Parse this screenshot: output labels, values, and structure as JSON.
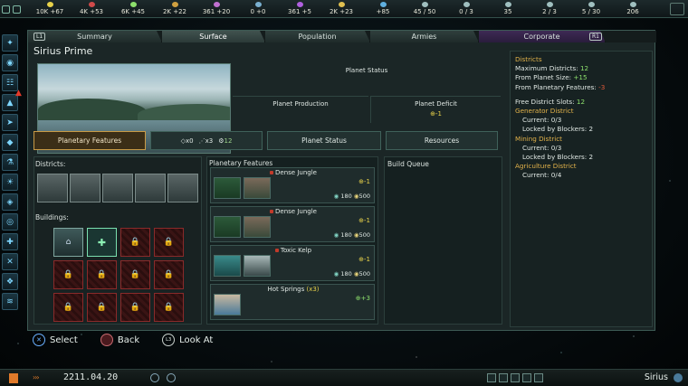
{
  "topbar": {
    "resources": [
      {
        "icon": "energy-icon",
        "value": "10K +67",
        "color": "#e8d24a"
      },
      {
        "icon": "minerals-icon",
        "value": "4K +53",
        "color": "#d04a4a"
      },
      {
        "icon": "food-icon",
        "value": "6K +45",
        "color": "#8de06c"
      },
      {
        "icon": "consumer-goods-icon",
        "value": "2K +22",
        "color": "#d0a040"
      },
      {
        "icon": "alloys-icon",
        "value": "361 +20",
        "color": "#c070d0"
      },
      {
        "icon": "strategic-icon",
        "value": "0 +0",
        "color": "#7ab0d0"
      },
      {
        "icon": "influence-icon",
        "value": "361 +5",
        "color": "#b060e0"
      },
      {
        "icon": "unity-icon",
        "value": "2K +23",
        "color": "#e0c050"
      },
      {
        "icon": "research-icon",
        "value": "+85",
        "color": "#60b0e0"
      },
      {
        "icon": "fleet-icon",
        "value": "45 / 50",
        "color": "#a0c0c0"
      },
      {
        "icon": "starbase-icon",
        "value": "0 / 3",
        "color": "#a0c0c0"
      },
      {
        "icon": "systems-icon",
        "value": "35",
        "color": "#a0c0c0"
      },
      {
        "icon": "planets-icon",
        "value": "2 / 3",
        "color": "#a0c0c0"
      },
      {
        "icon": "pops-icon",
        "value": "5 / 30",
        "color": "#a0c0c0"
      },
      {
        "icon": "stability-icon",
        "value": "206",
        "color": "#a0c0c0"
      }
    ]
  },
  "tabs": {
    "l1": "L1",
    "r1": "R1",
    "items": [
      {
        "label": "Summary"
      },
      {
        "label": "Surface"
      },
      {
        "label": "Population"
      },
      {
        "label": "Armies"
      },
      {
        "label": "Corporate"
      }
    ]
  },
  "planet": {
    "name": "Sirius Prime",
    "status_title": "Planet Status",
    "production_label": "Planet Production",
    "deficit_label": "Planet Deficit",
    "deficit_value": "-1"
  },
  "row_buttons": {
    "features": "Planetary Features",
    "counts": [
      {
        "icon": "blocker-icon",
        "value": "x0"
      },
      {
        "icon": "hazard-icon",
        "value": "x3"
      },
      {
        "icon": "cost-icon",
        "value": "12"
      }
    ],
    "status": "Planet Status",
    "resources": "Resources"
  },
  "sections": {
    "districts": "Districts:",
    "buildings": "Buildings:",
    "features": "Planetary Features",
    "queue": "Build Queue"
  },
  "features": [
    {
      "name": "Dense Jungle",
      "count": "",
      "effect": "-1",
      "cost_a": "180",
      "cost_b": "500"
    },
    {
      "name": "Dense Jungle",
      "count": "",
      "effect": "-1",
      "cost_a": "180",
      "cost_b": "500"
    },
    {
      "name": "Toxic Kelp",
      "count": "",
      "effect": "-1",
      "cost_a": "180",
      "cost_b": "500"
    },
    {
      "name": "Hot Springs",
      "count": "(x3)",
      "effect": "+3",
      "cost_a": "",
      "cost_b": ""
    }
  ],
  "info": {
    "districts_title": "Districts",
    "max_label": "Maximum Districts:",
    "max_value": "12",
    "size_label": "From Planet Size:",
    "size_value": "+15",
    "features_label": "From Planetary Features:",
    "features_value": "-3",
    "free_label": "Free District Slots:",
    "free_value": "12",
    "generator_title": "Generator District",
    "generator_current": "Current: 0/3",
    "generator_locked": "Locked by Blockers: 2",
    "mining_title": "Mining District",
    "mining_current": "Current: 0/3",
    "mining_locked": "Locked by Blockers: 2",
    "agri_title": "Agriculture District",
    "agri_current": "Current: 0/4"
  },
  "controls": {
    "select": "Select",
    "back": "Back",
    "look": "Look At",
    "l3": "L3"
  },
  "bottom": {
    "date": "2211.04.20",
    "location": "Sirius"
  }
}
